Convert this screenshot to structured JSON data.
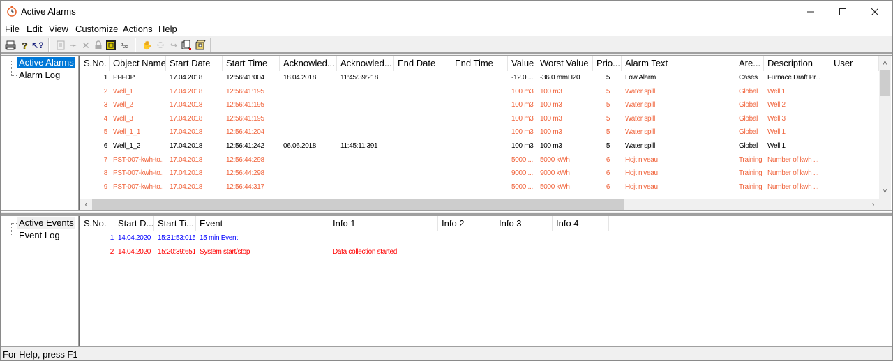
{
  "window": {
    "title": "Active Alarms",
    "icon": "alarm-clock-icon",
    "controls": [
      "minimize",
      "maximize",
      "close"
    ]
  },
  "menu": [
    {
      "label": "File",
      "mnemonic": "F"
    },
    {
      "label": "Edit",
      "mnemonic": "E"
    },
    {
      "label": "View",
      "mnemonic": "V"
    },
    {
      "label": "Customize",
      "mnemonic": "C"
    },
    {
      "label": "Actions",
      "mnemonic": "t"
    },
    {
      "label": "Help",
      "mnemonic": "H"
    }
  ],
  "toolbar": {
    "groups": [
      [
        "print-icon",
        "help-icon",
        "context-help-icon"
      ],
      [
        "properties-icon",
        "acknowledge-icon",
        "delete-icon",
        "lock-icon",
        "filter-icon",
        "numbering-icon"
      ],
      [
        "acknowledge-all-icon",
        "find-icon",
        "shelve-icon",
        "export-icon",
        "archive-icon"
      ]
    ]
  },
  "alarms": {
    "tree": {
      "items": [
        {
          "label": "Active Alarms",
          "selected": true
        },
        {
          "label": "Alarm Log",
          "selected": false
        }
      ]
    },
    "columns": [
      "S.No.",
      "Object Name",
      "Start Date",
      "Start Time",
      "Acknowled...",
      "Acknowled...",
      "End Date",
      "End Time",
      "Value",
      "Worst Value",
      "Prio...",
      "Alarm Text",
      "Are...",
      "Description",
      "User"
    ],
    "rows": [
      {
        "sno": "1",
        "object": "PI-FDP",
        "start_date": "17.04.2018",
        "start_time": "12:56:41:004",
        "ack_date": "18.04.2018",
        "ack_time": "11:45:39:218",
        "end_date": "",
        "end_time": "",
        "value": "-12.0 ...",
        "worst": "-36.0 mmH20",
        "prio": "5",
        "text": "Low Alarm",
        "area": "Cases",
        "desc": "Furnace Draft Pr...",
        "user": "",
        "color": "black"
      },
      {
        "sno": "2",
        "object": "Well_1",
        "start_date": "17.04.2018",
        "start_time": "12:56:41:195",
        "ack_date": "",
        "ack_time": "",
        "end_date": "",
        "end_time": "",
        "value": "100 m3",
        "worst": "100 m3",
        "prio": "5",
        "text": "Water spill",
        "area": "Global",
        "desc": "Well 1",
        "user": "",
        "color": "orange"
      },
      {
        "sno": "3",
        "object": "Well_2",
        "start_date": "17.04.2018",
        "start_time": "12:56:41:195",
        "ack_date": "",
        "ack_time": "",
        "end_date": "",
        "end_time": "",
        "value": "100 m3",
        "worst": "100 m3",
        "prio": "5",
        "text": "Water spill",
        "area": "Global",
        "desc": "Well 2",
        "user": "",
        "color": "orange"
      },
      {
        "sno": "4",
        "object": "Well_3",
        "start_date": "17.04.2018",
        "start_time": "12:56:41:195",
        "ack_date": "",
        "ack_time": "",
        "end_date": "",
        "end_time": "",
        "value": "100 m3",
        "worst": "100 m3",
        "prio": "5",
        "text": "Water spill",
        "area": "Global",
        "desc": "Well 3",
        "user": "",
        "color": "orange"
      },
      {
        "sno": "5",
        "object": "Well_1_1",
        "start_date": "17.04.2018",
        "start_time": "12:56:41:204",
        "ack_date": "",
        "ack_time": "",
        "end_date": "",
        "end_time": "",
        "value": "100 m3",
        "worst": "100 m3",
        "prio": "5",
        "text": "Water spill",
        "area": "Global",
        "desc": "Well 1",
        "user": "",
        "color": "orange"
      },
      {
        "sno": "6",
        "object": "Well_1_2",
        "start_date": "17.04.2018",
        "start_time": "12:56:41:242",
        "ack_date": "06.06.2018",
        "ack_time": "11:45:11:391",
        "end_date": "",
        "end_time": "",
        "value": "100 m3",
        "worst": "100 m3",
        "prio": "5",
        "text": "Water spill",
        "area": "Global",
        "desc": "Well 1",
        "user": "",
        "color": "black"
      },
      {
        "sno": "7",
        "object": "PST-007-kwh-to...",
        "start_date": "17.04.2018",
        "start_time": "12:56:44:298",
        "ack_date": "",
        "ack_time": "",
        "end_date": "",
        "end_time": "",
        "value": "5000 ...",
        "worst": "5000 kWh",
        "prio": "6",
        "text": "Hojt niveau",
        "area": "Training",
        "desc": "Number of kwh ...",
        "user": "",
        "color": "orange"
      },
      {
        "sno": "8",
        "object": "PST-007-kwh-to...",
        "start_date": "17.04.2018",
        "start_time": "12:56:44:298",
        "ack_date": "",
        "ack_time": "",
        "end_date": "",
        "end_time": "",
        "value": "9000 ...",
        "worst": "9000 kWh",
        "prio": "6",
        "text": "Hojt niveau",
        "area": "Training",
        "desc": "Number of kwh ...",
        "user": "",
        "color": "orange"
      },
      {
        "sno": "9",
        "object": "PST-007-kwh-to...",
        "start_date": "17.04.2018",
        "start_time": "12:56:44:317",
        "ack_date": "",
        "ack_time": "",
        "end_date": "",
        "end_time": "",
        "value": "5000 ...",
        "worst": "5000 kWh",
        "prio": "6",
        "text": "Hojt niveau",
        "area": "Training",
        "desc": "Number of kwh ...",
        "user": "",
        "color": "orange"
      }
    ]
  },
  "events": {
    "tree": {
      "items": [
        {
          "label": "Active Events",
          "selected": false
        },
        {
          "label": "Event Log",
          "selected": false
        }
      ]
    },
    "columns": [
      "S.No.",
      "Start D...",
      "Start Ti...",
      "Event",
      "Info 1",
      "Info 2",
      "Info 3",
      "Info 4"
    ],
    "rows": [
      {
        "sno": "1",
        "start_date": "14.04.2020",
        "start_time": "15:31:53:015",
        "event": "15 min Event",
        "info1": "",
        "info2": "",
        "info3": "",
        "info4": "",
        "color": "blue"
      },
      {
        "sno": "2",
        "start_date": "14.04.2020",
        "start_time": "15:20:39:651",
        "event": "System start/stop",
        "info1": "Data collection started",
        "info2": "",
        "info3": "",
        "info4": "",
        "color": "red"
      }
    ]
  },
  "status": {
    "text": "For Help, press F1"
  },
  "colors": {
    "selection": "#0078d7",
    "alarm_unacked": "#f0643c",
    "alarm_acked": "#000000",
    "event_info": "#0000ff",
    "event_system": "#ff0000"
  }
}
